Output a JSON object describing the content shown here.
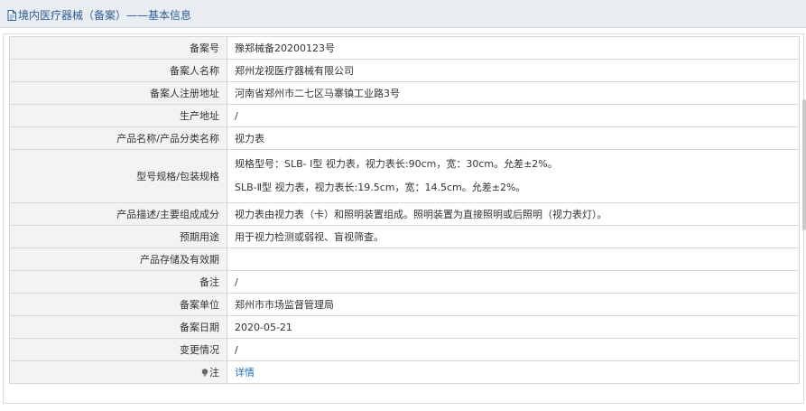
{
  "header": {
    "title": "境内医疗器械（备案）——基本信息"
  },
  "rows": [
    {
      "label": "备案号",
      "value": "豫郑械备20200123号"
    },
    {
      "label": "备案人名称",
      "value": "郑州龙视医疗器械有限公司"
    },
    {
      "label": "备案人注册地址",
      "value": "河南省郑州市二七区马寨镇工业路3号"
    },
    {
      "label": "生产地址",
      "value": "/"
    },
    {
      "label": "产品名称/产品分类名称",
      "value": "视力表"
    },
    {
      "label": "型号规格/包装规格",
      "lines": [
        "规格型号：SLB- Ⅰ型 视力表，视力表长:90cm，宽：30cm。允差±2%。",
        "SLB-Ⅱ型 视力表，视力表长:19.5cm，宽：14.5cm。允差±2%。"
      ]
    },
    {
      "label": "产品描述/主要组成成分",
      "value": "视力表由视力表（卡）和照明装置组成。照明装置为直接照明或后照明（视力表灯）。"
    },
    {
      "label": "预期用途",
      "value": "用于视力检测或弱视、盲视筛查。"
    },
    {
      "label": "产品存储及有效期",
      "value": ""
    },
    {
      "label": "备注",
      "value": "/"
    },
    {
      "label": "备案单位",
      "value": "郑州市市场监督管理局"
    },
    {
      "label": "备案日期",
      "value": "2020-05-21"
    },
    {
      "label": "变更情况",
      "value": "/"
    },
    {
      "label": "注",
      "value": "详情"
    }
  ],
  "colors": {
    "header_bg": "#e9ecf0",
    "title": "#2b5d96",
    "label_bg": "#f3f3f3",
    "link": "#1f6fbf",
    "border": "#d7d7d7"
  },
  "icons": {
    "header": "document-icon",
    "note": "lightbulb-icon"
  }
}
